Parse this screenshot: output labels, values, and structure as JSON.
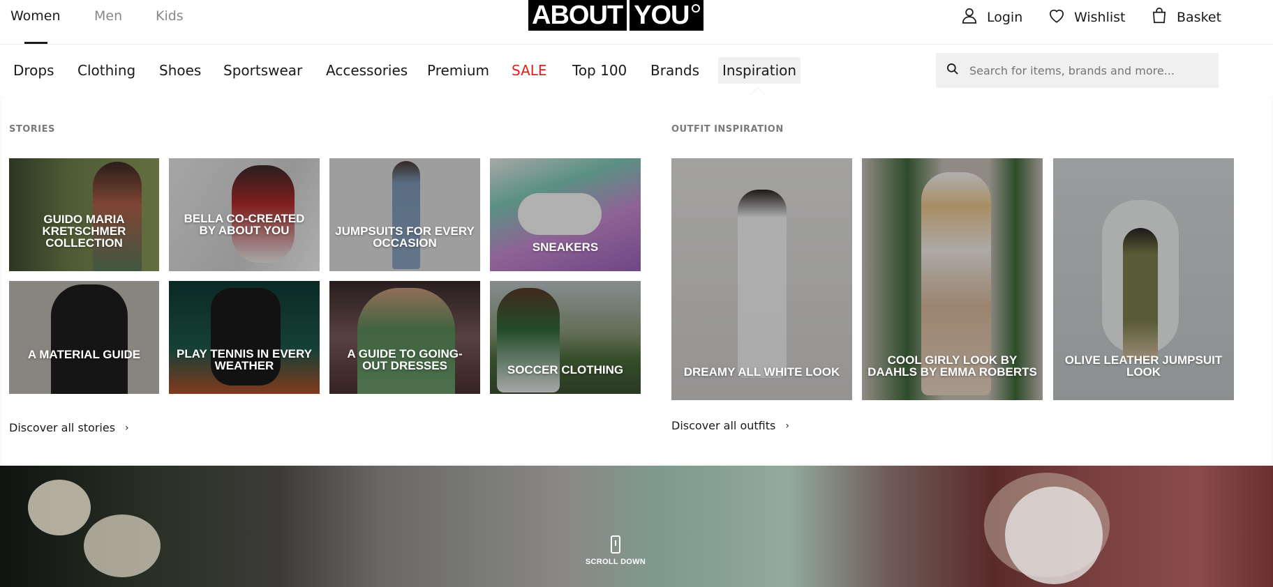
{
  "header": {
    "genders": [
      {
        "label": "Women",
        "active": true
      },
      {
        "label": "Men",
        "active": false
      },
      {
        "label": "Kids",
        "active": false
      }
    ],
    "logo": {
      "part1": "ABOUT",
      "part2": "YOU"
    },
    "actions": {
      "login": "Login",
      "wishlist": "Wishlist",
      "basket": "Basket"
    }
  },
  "nav": {
    "items": [
      {
        "label": "Drops"
      },
      {
        "label": "Clothing"
      },
      {
        "label": "Shoes"
      },
      {
        "label": "Sportswear"
      },
      {
        "label": "Accessories"
      },
      {
        "label": "Premium"
      },
      {
        "label": "SALE",
        "highlight": "#e4201b"
      },
      {
        "label": "Top 100"
      },
      {
        "label": "Brands"
      },
      {
        "label": "Inspiration",
        "active": true
      }
    ],
    "search": {
      "placeholder": "Search for items, brands and more..."
    }
  },
  "stories": {
    "title": "STORIES",
    "items": [
      {
        "label": "GUIDO MARIA KRETSCHMER COLLECTION",
        "bg": "#5d6b45"
      },
      {
        "label": "BELLA CO-CREATED BY ABOUT YOU",
        "bg": "#cfcfcf"
      },
      {
        "label": "JUMPSUITS FOR EVERY OCCASION",
        "bg": "#d8d8d6"
      },
      {
        "label": "SNEAKERS",
        "bg": "#b58bb8"
      },
      {
        "label": "A MATERIAL GUIDE",
        "bg": "#b7b2ac"
      },
      {
        "label": "PLAY TENNIS IN EVERY WEATHER",
        "bg": "#1f5a4c"
      },
      {
        "label": "A GUIDE TO GOING-OUT DRESSES",
        "bg": "#6b4a4a"
      },
      {
        "label": "SOCCER CLOTHING",
        "bg": "#6f7f5f"
      }
    ],
    "discover": "Discover all stories"
  },
  "outfits": {
    "title": "OUTFIT INSPIRATION",
    "items": [
      {
        "label": "DREAMY ALL WHITE LOOK",
        "bg": "#d9d7d5"
      },
      {
        "label": "COOL GIRLY LOOK BY DAAHLS BY EMMA ROBERTS",
        "bg": "#c8c0b8"
      },
      {
        "label": "OLIVE LEATHER JUMPSUIT LOOK",
        "bg": "#cdd1d2"
      }
    ],
    "discover": "Discover all outfits"
  },
  "hero": {
    "scroll_label": "SCROLL DOWN"
  }
}
